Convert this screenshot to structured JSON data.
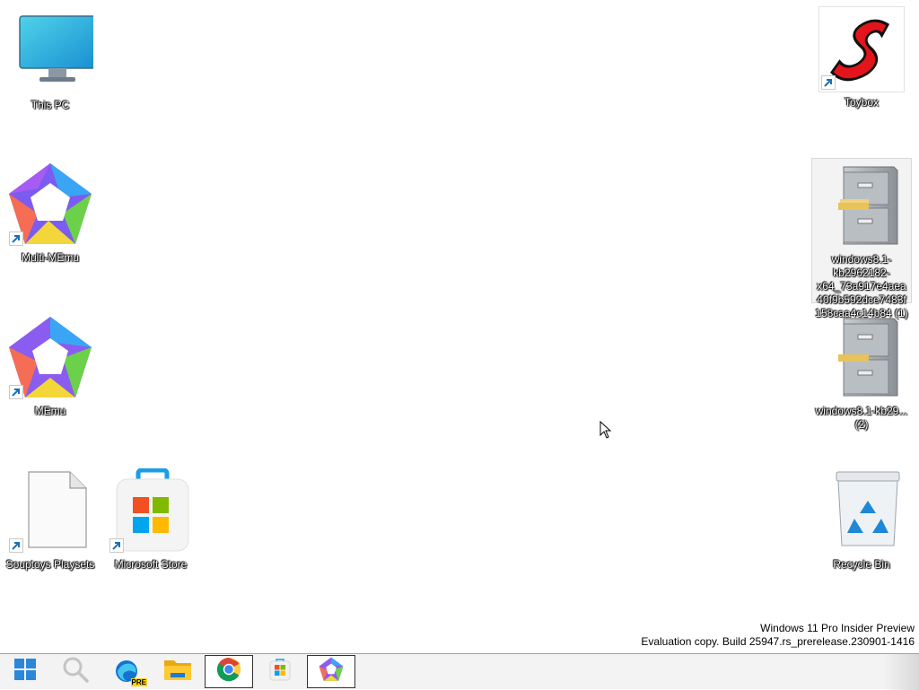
{
  "desktop": {
    "icons": {
      "this_pc": "This PC",
      "multi_memu": "Multi-MEmu",
      "memu": "MEmu",
      "souptoys": "Souptoys Playsets",
      "ms_store": "Microsoft Store",
      "toybox": "Toybox",
      "archive1": "windows8.1-kb2962182-x64_73a917e4aea40f9b592dce7483f158caa4c14b84 (1)",
      "archive2": "windows8.1-kb29... (2)",
      "recycle_bin": "Recycle Bin"
    }
  },
  "watermark": {
    "line1": "Windows 11 Pro Insider Preview",
    "line2": "Evaluation copy. Build 25947.rs_prerelease.230901-1416"
  },
  "taskbar": {
    "items": [
      "start-icon",
      "search-icon",
      "edge-preview-icon",
      "file-explorer-icon",
      "chrome-icon",
      "microsoft-store-icon",
      "memu-icon"
    ],
    "edge_badge": "PRE"
  },
  "colors": {
    "desktop_bg": "#ffffff",
    "taskbar_bg": "#f3f3f3",
    "start_blue": "#2b88d8"
  }
}
